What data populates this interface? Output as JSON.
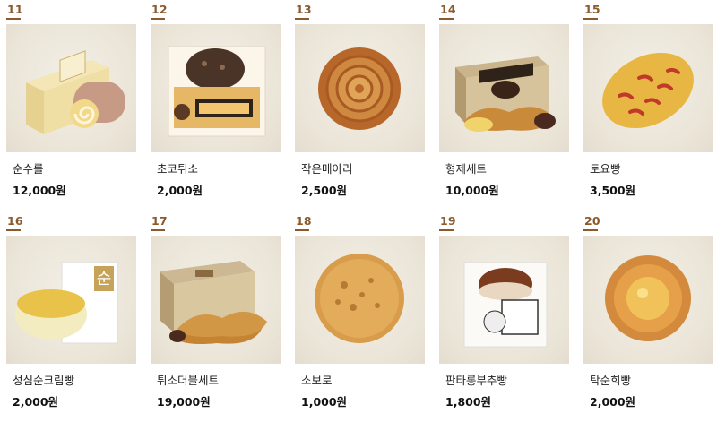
{
  "products": [
    {
      "no": "11",
      "name": "순수롤",
      "price": "12,000원",
      "icon": "roll-cake-box-image"
    },
    {
      "no": "12",
      "name": "초코튀소",
      "price": "2,000원",
      "icon": "choco-bun-package-image"
    },
    {
      "no": "13",
      "name": "작은메아리",
      "price": "2,500원",
      "icon": "spiral-pastry-image"
    },
    {
      "no": "14",
      "name": "형제세트",
      "price": "10,000원",
      "icon": "pastry-set-box-image"
    },
    {
      "no": "15",
      "name": "토요빵",
      "price": "3,500원",
      "icon": "oval-bread-image"
    },
    {
      "no": "16",
      "name": "성심순크림빵",
      "price": "2,000원",
      "icon": "cream-bun-image"
    },
    {
      "no": "17",
      "name": "튀소더블세트",
      "price": "19,000원",
      "icon": "double-set-box-image"
    },
    {
      "no": "18",
      "name": "소보로",
      "price": "1,000원",
      "icon": "streusel-bun-image"
    },
    {
      "no": "19",
      "name": "판타롱부추빵",
      "price": "1,800원",
      "icon": "chive-bun-package-image"
    },
    {
      "no": "20",
      "name": "탁순희빵",
      "price": "2,000원",
      "icon": "round-bread-image"
    }
  ]
}
